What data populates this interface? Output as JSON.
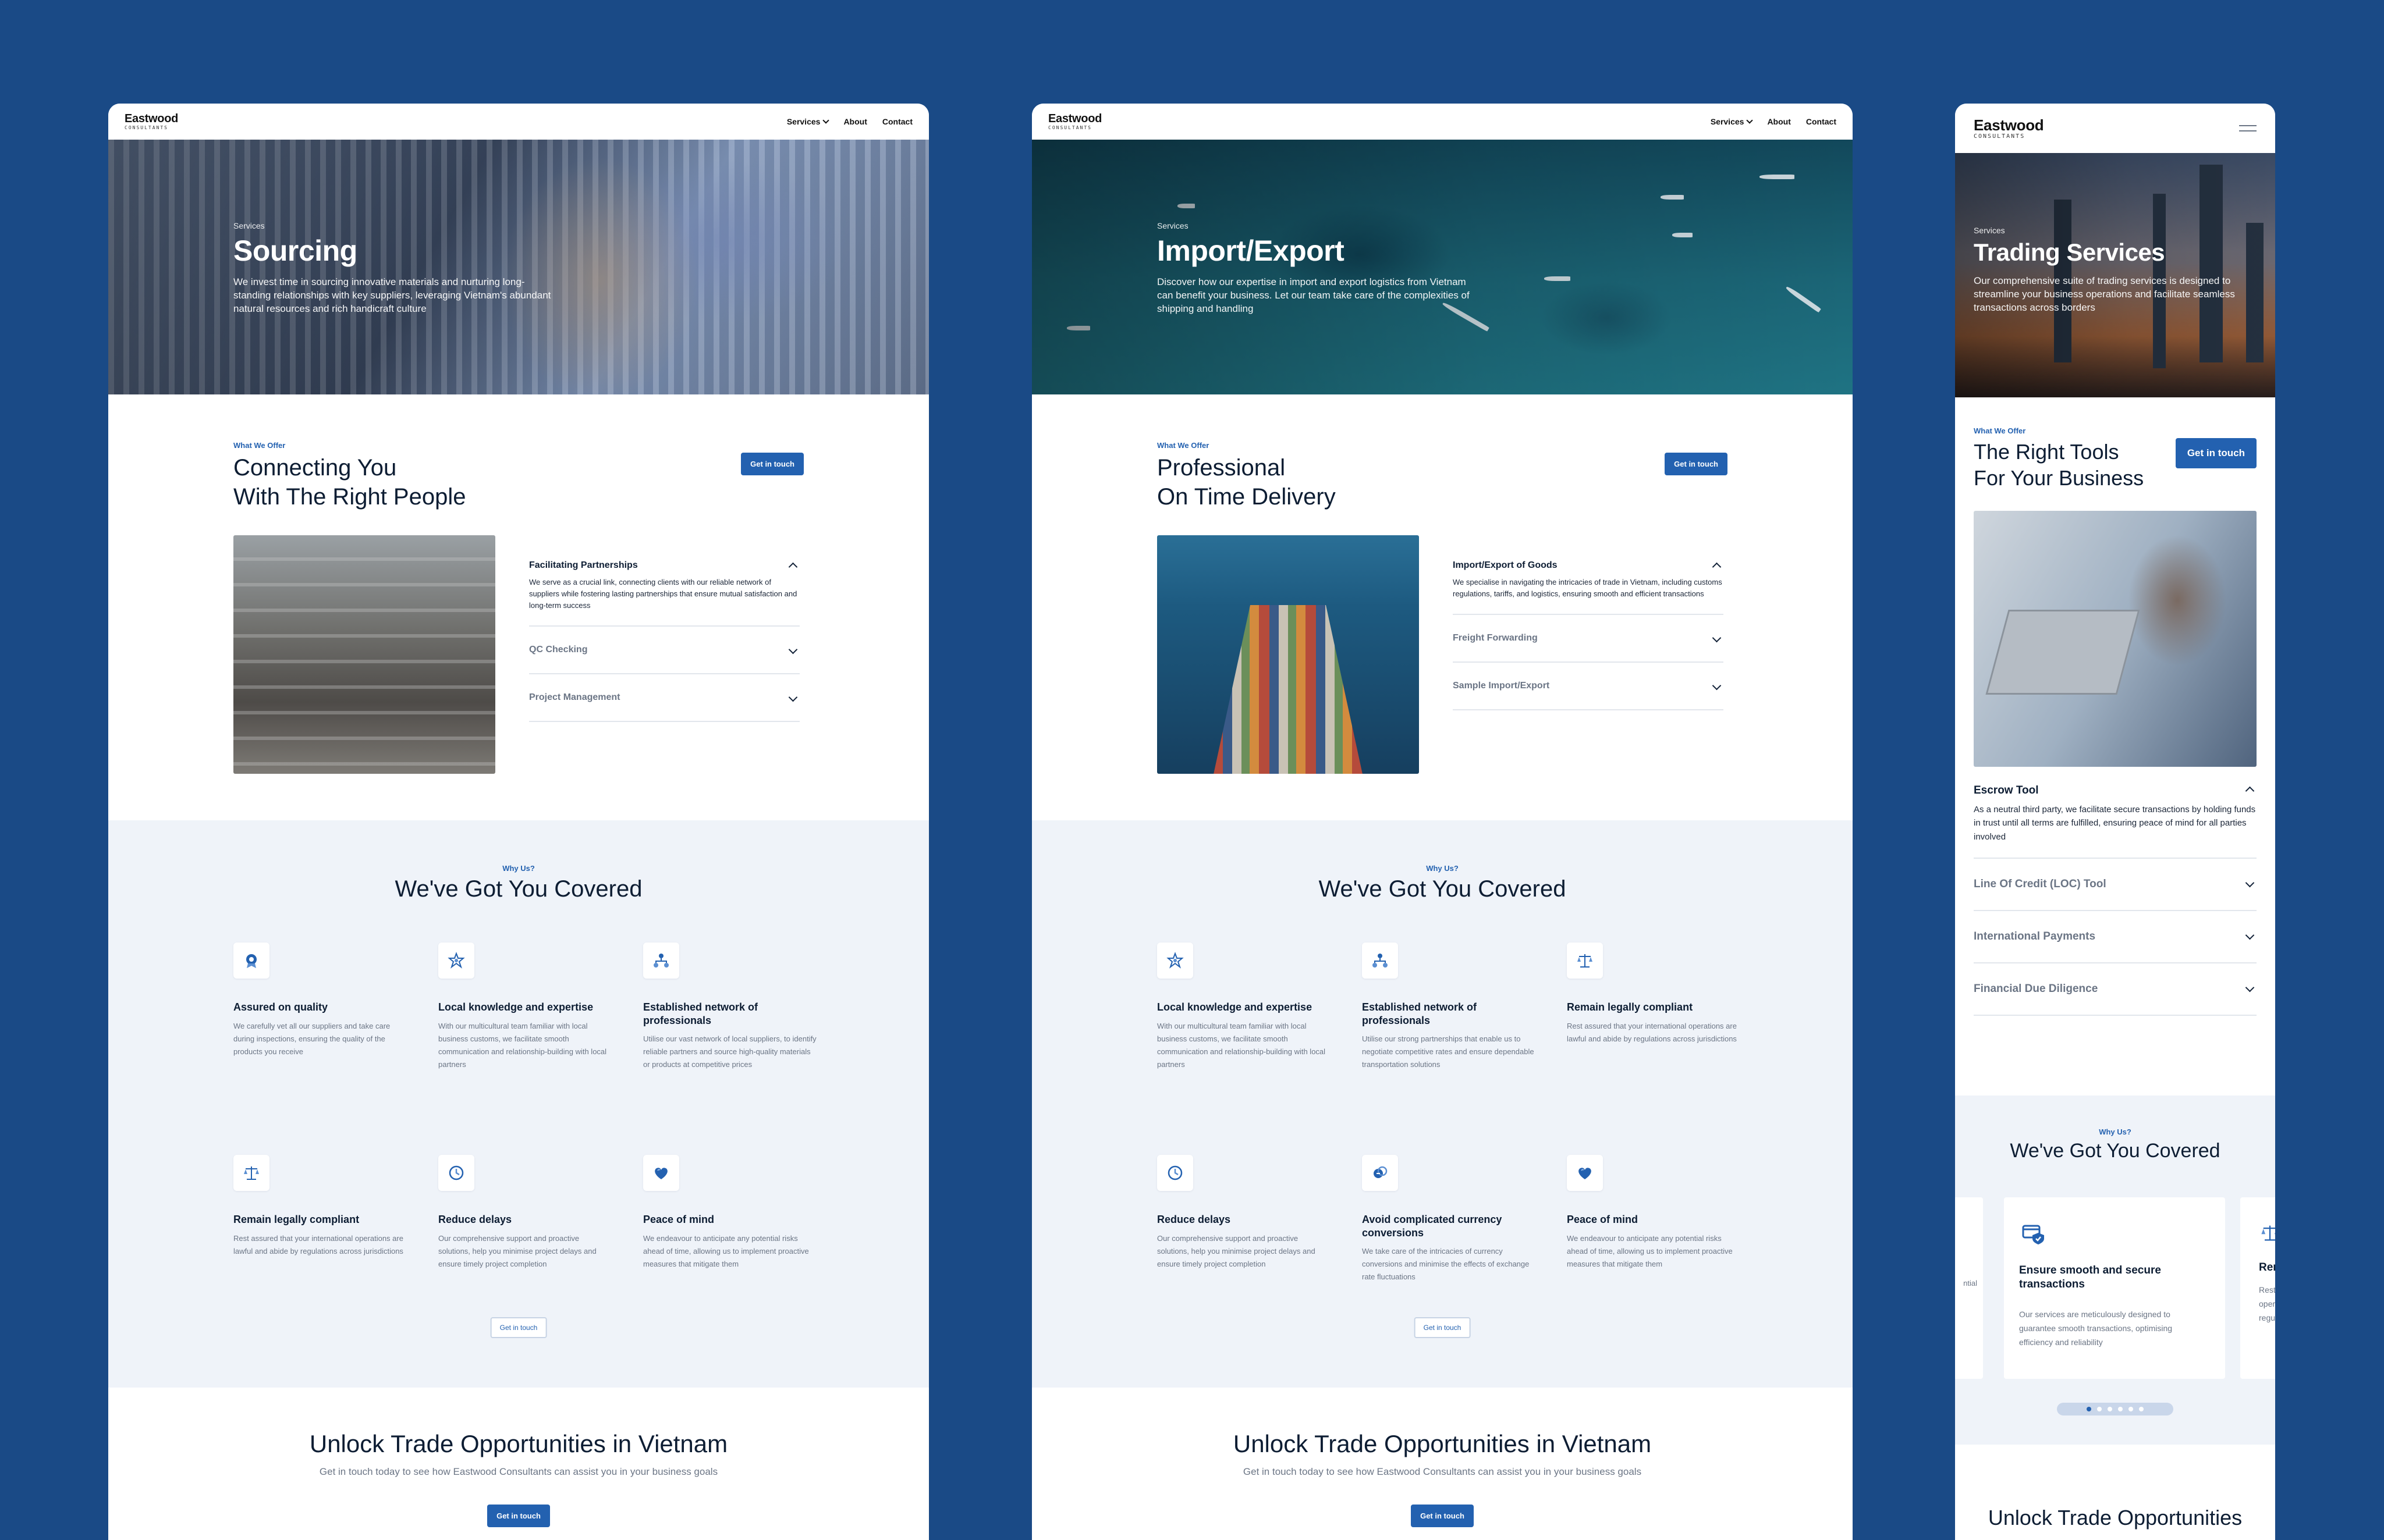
{
  "colors": {
    "background": "#1a4a86",
    "accent": "#2361b0",
    "section_bg": "#eff3f9"
  },
  "brand": {
    "name": "Eastwood",
    "tagline": "CONSULTANTS"
  },
  "nav": {
    "services": "Services",
    "about": "About",
    "contact": "Contact"
  },
  "pages": [
    {
      "hero": {
        "kicker": "Services",
        "title": "Sourcing",
        "desc": "We invest time in sourcing innovative materials and nurturing long-standing relationships with key suppliers, leveraging Vietnam's abundant natural resources and rich handicraft culture"
      },
      "offer": {
        "kicker": "What We Offer",
        "title_1": "Connecting You",
        "title_2": "With The Right People",
        "button": "Get in touch"
      },
      "accordion": [
        {
          "title": "Facilitating Partnerships",
          "body": "We serve as a crucial link, connecting clients with our reliable network of suppliers while fostering lasting partnerships that ensure mutual satisfaction and long-term success",
          "open": true
        },
        {
          "title": "QC Checking",
          "open": false
        },
        {
          "title": "Project Management",
          "open": false
        }
      ],
      "why": {
        "kicker": "Why Us?",
        "title": "We've Got You Covered",
        "button": "Get in touch",
        "features": [
          {
            "icon": "badge-icon",
            "title": "Assured on quality",
            "desc": "We carefully vet all our suppliers and take care during inspections, ensuring the quality of the products you receive"
          },
          {
            "icon": "star-network-icon",
            "title": "Local knowledge and expertise",
            "desc": "With our multicultural team familiar with local business customs, we facilitate smooth communication and relationship-building with local partners"
          },
          {
            "icon": "hierarchy-icon",
            "title": "Established network of professionals",
            "desc": "Utilise our vast network of local suppliers, to identify reliable partners and source high-quality materials or products at competitive prices"
          },
          {
            "icon": "scales-icon",
            "title": "Remain legally compliant",
            "desc": "Rest assured that your international operations are lawful and abide by regulations across jurisdictions"
          },
          {
            "icon": "clock-icon",
            "title": "Reduce delays",
            "desc": "Our comprehensive support and proactive solutions, help you minimise project delays and ensure timely project completion"
          },
          {
            "icon": "heart-icon",
            "title": "Peace of mind",
            "desc": "We endeavour to anticipate any potential risks ahead of time, allowing us to implement proactive measures that mitigate them"
          }
        ]
      },
      "cta": {
        "title": "Unlock Trade Opportunities in Vietnam",
        "sub": "Get in touch today to see how Eastwood Consultants can assist you in your business goals",
        "button": "Get in touch"
      }
    },
    {
      "hero": {
        "kicker": "Services",
        "title": "Import/Export",
        "desc": "Discover how our expertise in import and export logistics from Vietnam can benefit your business. Let our team take care of the complexities of shipping and handling"
      },
      "offer": {
        "kicker": "What We Offer",
        "title_1": "Professional",
        "title_2": "On Time Delivery",
        "button": "Get in touch"
      },
      "accordion": [
        {
          "title": "Import/Export of Goods",
          "body": "We specialise in navigating the intricacies of trade in Vietnam, including customs regulations, tariffs, and logistics, ensuring smooth and efficient transactions",
          "open": true
        },
        {
          "title": "Freight Forwarding",
          "open": false
        },
        {
          "title": "Sample Import/Export",
          "open": false
        }
      ],
      "why": {
        "kicker": "Why Us?",
        "title": "We've Got You Covered",
        "button": "Get in touch",
        "features": [
          {
            "icon": "star-network-icon",
            "title": "Local knowledge and expertise",
            "desc": "With our multicultural team familiar with local business customs, we facilitate smooth communication and relationship-building with local partners"
          },
          {
            "icon": "hierarchy-icon",
            "title": "Established network of professionals",
            "desc": "Utilise our strong partnerships that enable us to negotiate competitive rates and ensure dependable transportation solutions"
          },
          {
            "icon": "scales-icon",
            "title": "Remain legally compliant",
            "desc": "Rest assured that your international operations are lawful and abide by regulations across jurisdictions"
          },
          {
            "icon": "clock-icon",
            "title": "Reduce delays",
            "desc": "Our comprehensive support and proactive solutions, help you minimise project delays and ensure timely project completion"
          },
          {
            "icon": "currency-exchange-icon",
            "title": "Avoid complicated currency conversions",
            "desc": "We take care of the intricacies of currency conversions and minimise the effects of exchange rate fluctuations"
          },
          {
            "icon": "heart-icon",
            "title": "Peace of mind",
            "desc": "We endeavour to anticipate any potential risks ahead of time, allowing us to implement proactive measures that mitigate them"
          }
        ]
      },
      "cta": {
        "title": "Unlock Trade Opportunities in Vietnam",
        "sub": "Get in touch today to see how Eastwood Consultants can assist you in your business goals",
        "button": "Get in touch"
      }
    },
    {
      "hero": {
        "kicker": "Services",
        "title": "Trading Services",
        "desc": "Our comprehensive suite of trading services is designed to streamline your business operations and facilitate seamless transactions across borders"
      },
      "offer": {
        "kicker": "What We Offer",
        "title_1": "The Right Tools",
        "title_2": "For Your Business",
        "button": "Get in touch"
      },
      "accordion": [
        {
          "title": "Escrow Tool",
          "body": "As a neutral third party, we facilitate secure transactions by holding funds in trust until all terms are fulfilled, ensuring peace of mind for all parties involved",
          "open": true
        },
        {
          "title": "Line Of Credit (LOC) Tool",
          "open": false
        },
        {
          "title": "International Payments",
          "open": false
        },
        {
          "title": "Financial Due Diligence",
          "open": false
        }
      ],
      "why": {
        "kicker": "Why Us?",
        "title": "We've Got You Covered",
        "card": {
          "icon": "secure-card-icon",
          "title": "Ensure smooth and secure transactions",
          "desc": "Our services are meticulously designed to guarantee smooth transactions, optimising efficiency and reliability"
        },
        "left_fragment": "ntial",
        "right_fragment_title": "Rem",
        "right_fragment_lines": [
          "Rest",
          "oper",
          "regu"
        ],
        "slides_total": 6,
        "slide_active": 1
      },
      "cta": {
        "title": "Unlock Trade Opportunities"
      }
    }
  ]
}
